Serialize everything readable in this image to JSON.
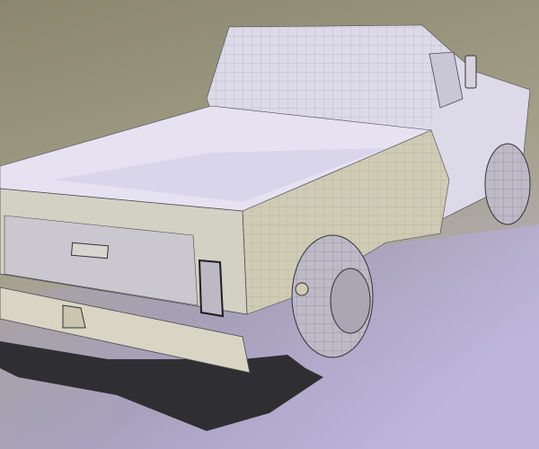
{
  "scene": {
    "subject": "pickup-truck-wireframe-render",
    "colors": {
      "background_top": "#8a876f",
      "background_bottom": "#b9b2d6",
      "body": "#dcd9e6",
      "body_shade": "#c7c3a8",
      "bed_inside": "#e6e2f2",
      "shadow": "#2f2e33",
      "tire": "#bdb9c6",
      "wire": "#4a4850"
    }
  }
}
